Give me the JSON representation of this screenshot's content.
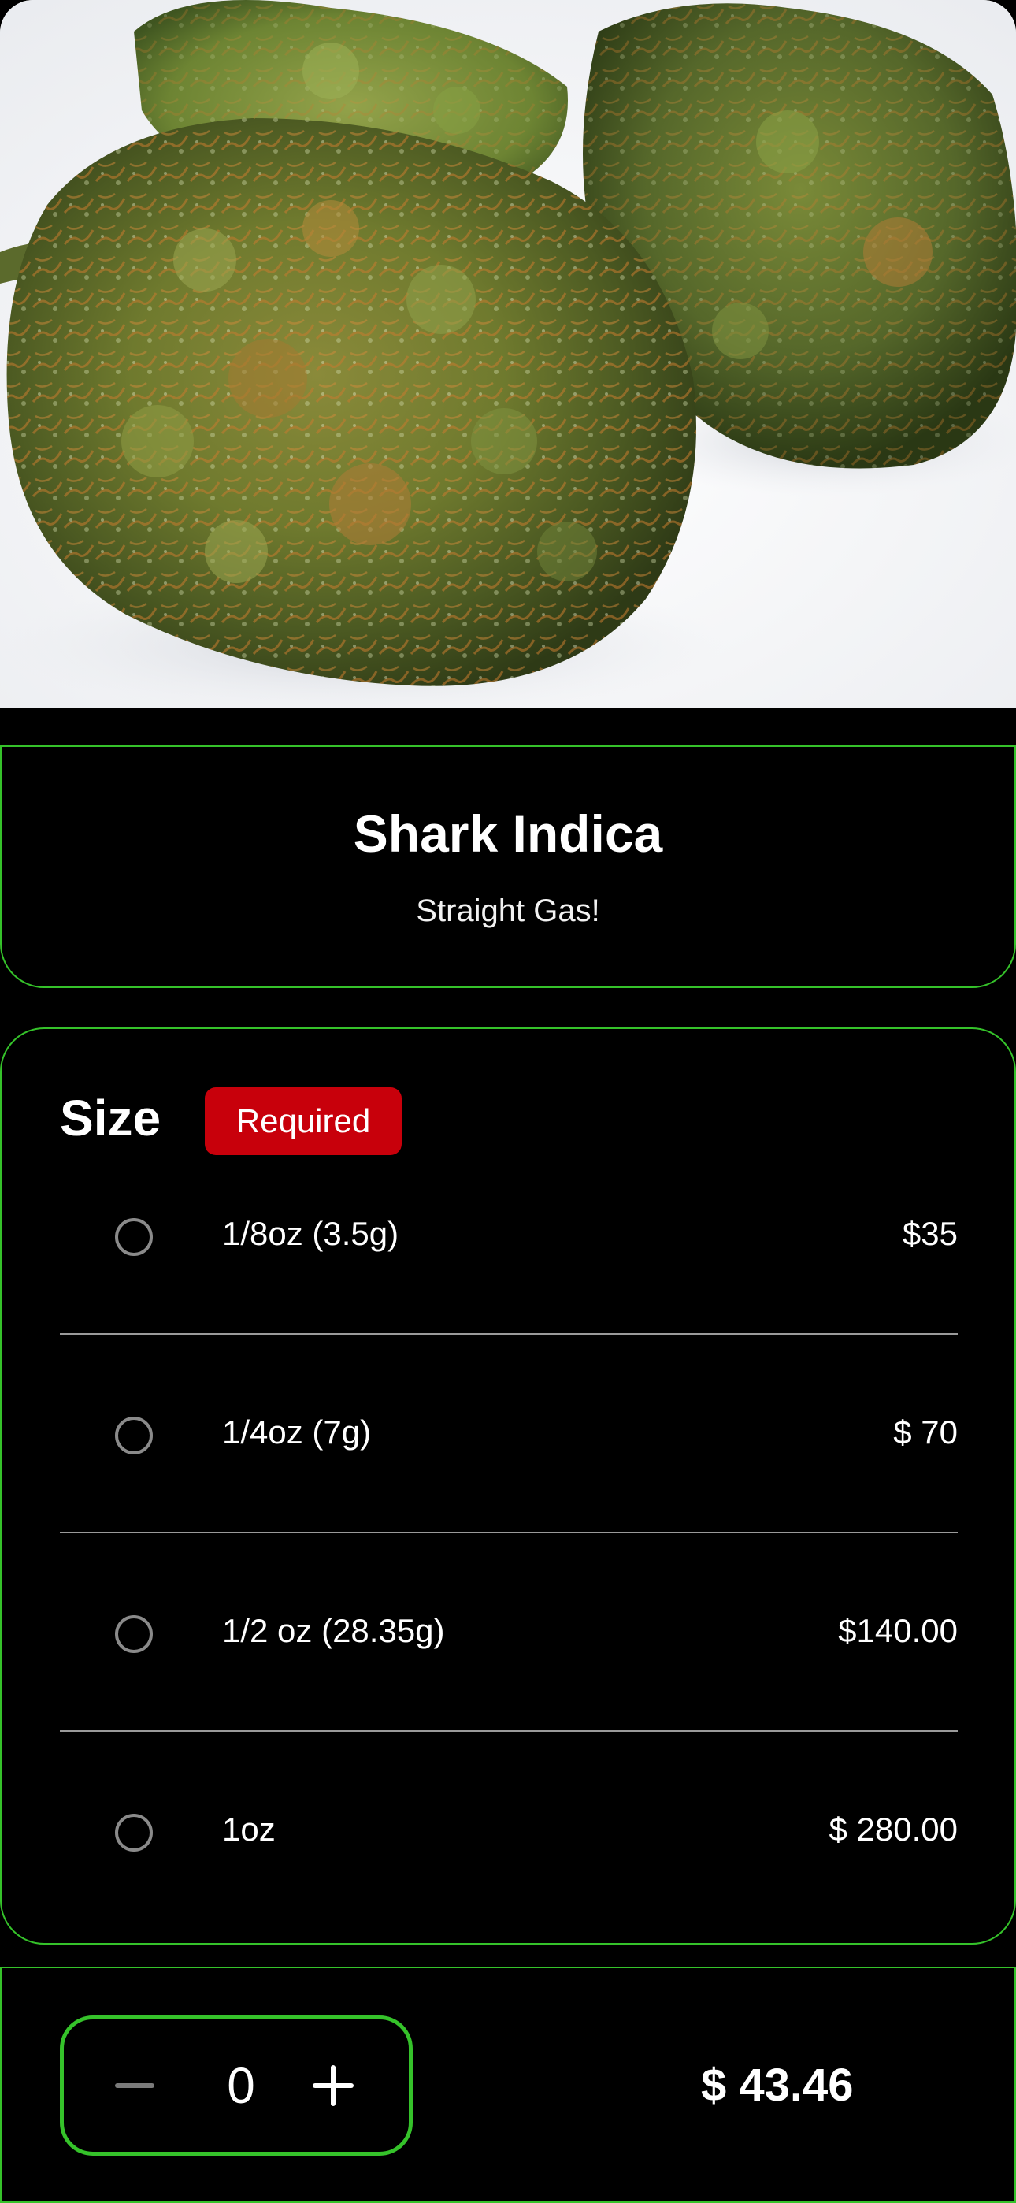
{
  "product": {
    "title": "Shark Indica",
    "subtitle": "Straight Gas!"
  },
  "size_section": {
    "label": "Size",
    "badge": "Required",
    "options": [
      {
        "label": "1/8oz (3.5g)",
        "price": "$35",
        "selected": false
      },
      {
        "label": "1/4oz (7g)",
        "price": "$ 70",
        "selected": false
      },
      {
        "label": "1/2 oz (28.35g)",
        "price": "$140.00",
        "selected": false
      },
      {
        "label": "1oz",
        "price": "$ 280.00",
        "selected": false
      }
    ]
  },
  "footer": {
    "quantity": "0",
    "total": "$ 43.46"
  },
  "colors": {
    "accent": "#35c22a",
    "badge": "#c8000b",
    "background": "#000000"
  },
  "icons": {
    "minus": "minus-icon",
    "plus": "plus-icon"
  }
}
